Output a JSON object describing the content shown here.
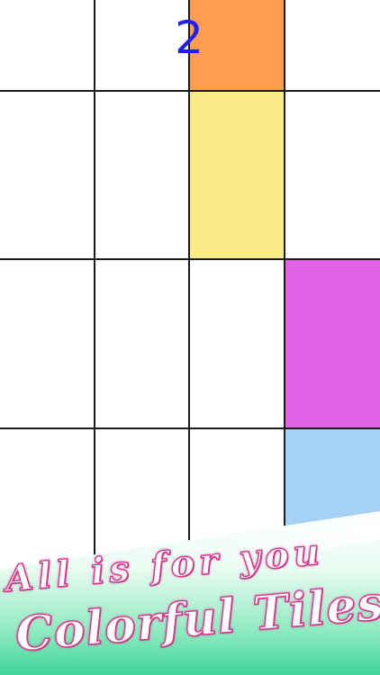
{
  "game": {
    "title": "Colorful Tiles",
    "score": "2",
    "colors": {
      "orange": "#fd9d4e",
      "yellow": "#fdeb87",
      "magenta": "#e262e5",
      "light_blue": "#a4d1f4",
      "score_text": "#1f1ff2",
      "grid_line": "#1a1a1a",
      "banner_pink": "#d43a8c",
      "banner_green": "#3fd49a"
    },
    "grid": {
      "columns": 4,
      "rows": 4
    }
  },
  "banner": {
    "line1": "All is for you",
    "line2": "Colorful Tiles"
  }
}
